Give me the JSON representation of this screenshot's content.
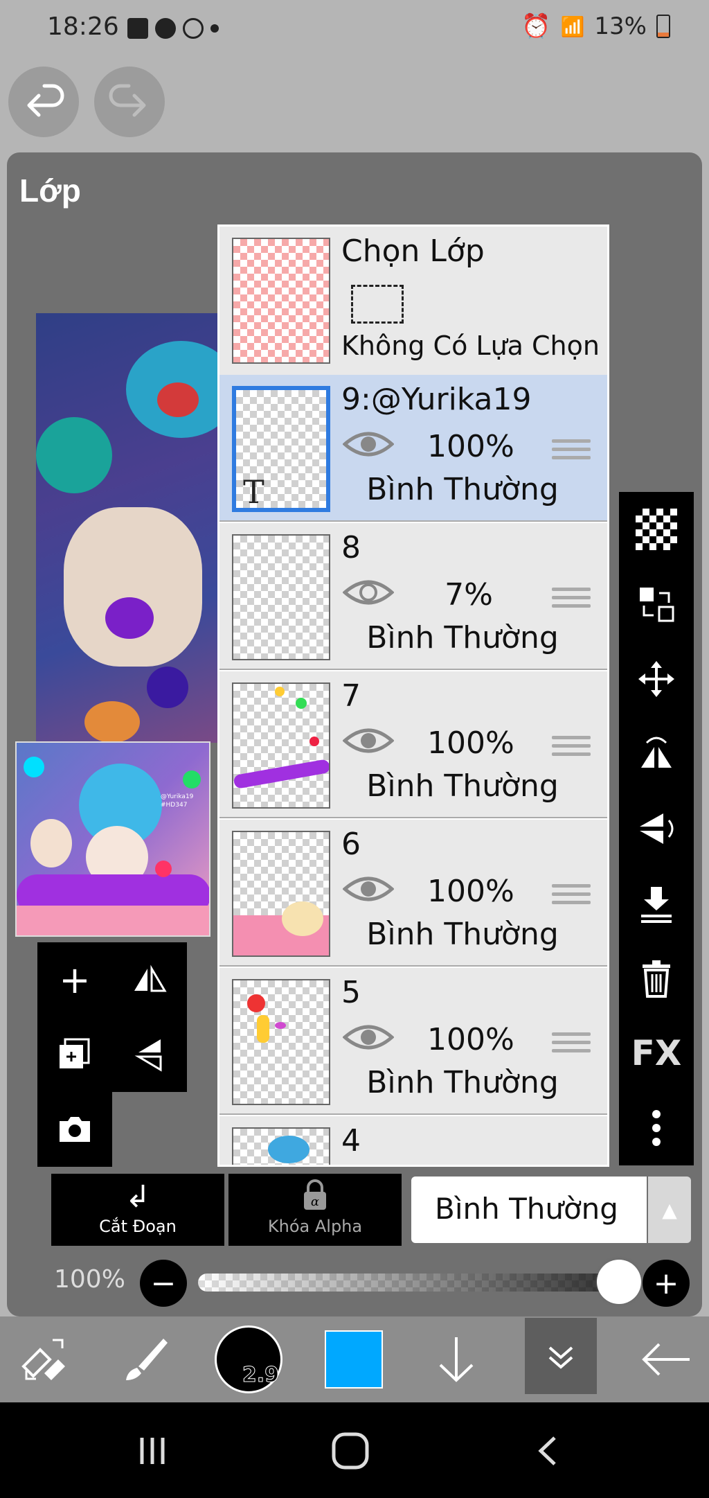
{
  "status_bar": {
    "time": "18:26",
    "battery": "13%"
  },
  "panel": {
    "title": "Lớp"
  },
  "layers": {
    "selection_layer": {
      "title": "Chọn Lớp",
      "subtitle": "Không Có Lựa Chọn"
    },
    "items": [
      {
        "name": "9:@Yurika19",
        "opacity": "100%",
        "blend": "Bình Thường",
        "selected": true,
        "text_layer_mark": "T"
      },
      {
        "name": "8",
        "opacity": "7%",
        "blend": "Bình Thường",
        "selected": false
      },
      {
        "name": "7",
        "opacity": "100%",
        "blend": "Bình Thường",
        "selected": false
      },
      {
        "name": "6",
        "opacity": "100%",
        "blend": "Bình Thường",
        "selected": false
      },
      {
        "name": "5",
        "opacity": "100%",
        "blend": "Bình Thường",
        "selected": false
      },
      {
        "name": "4"
      }
    ]
  },
  "right_toolbar": {
    "fx_label": "FX"
  },
  "bottom_controls": {
    "clip_label": "Cắt Đoạn",
    "alpha_lock_label": "Khóa Alpha",
    "blend_mode": "Bình Thường",
    "opacity_label": "100%",
    "opacity_value": 1.0
  },
  "thumb_art": {
    "signature": "@Yurika19",
    "tag": "#HD347"
  },
  "bottom_toolbar": {
    "brush_size": "2.9",
    "color": "#00a8ff"
  },
  "colors": {
    "selected_row": "#c9d8ef",
    "selection_border": "#2f7be0",
    "accent_color": "#00a8ff"
  }
}
